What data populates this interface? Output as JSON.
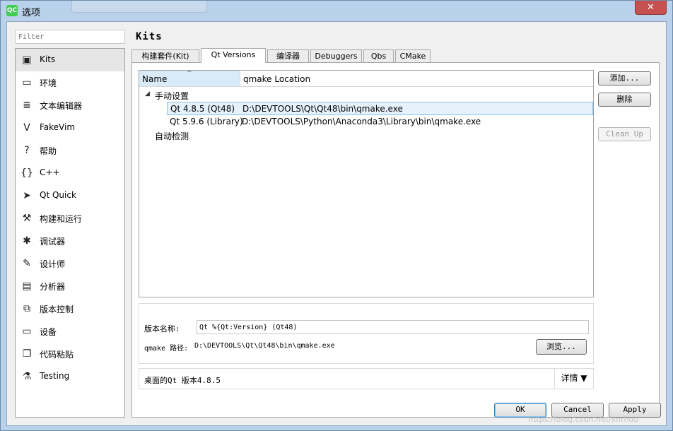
{
  "window": {
    "app_icon": "QC",
    "title": "选项",
    "close_glyph": "✕"
  },
  "filter": {
    "placeholder": "Filter"
  },
  "sidebar": {
    "items": [
      {
        "label": "Kits",
        "icon": "kits-icon",
        "glyph": "▣",
        "selected": true
      },
      {
        "label": "环境",
        "icon": "monitor-icon",
        "glyph": "▭"
      },
      {
        "label": "文本编辑器",
        "icon": "text-editor-icon",
        "glyph": "≣"
      },
      {
        "label": "FakeVim",
        "icon": "fakevim-icon",
        "glyph": "V"
      },
      {
        "label": "帮助",
        "icon": "help-icon",
        "glyph": "?"
      },
      {
        "label": "C++",
        "icon": "cpp-icon",
        "glyph": "{}"
      },
      {
        "label": "Qt Quick",
        "icon": "qt-quick-icon",
        "glyph": "➤"
      },
      {
        "label": "构建和运行",
        "icon": "hammer-icon",
        "glyph": "⚒"
      },
      {
        "label": "调试器",
        "icon": "bug-icon",
        "glyph": "✱"
      },
      {
        "label": "设计师",
        "icon": "pencil-icon",
        "glyph": "✎"
      },
      {
        "label": "分析器",
        "icon": "analyzer-icon",
        "glyph": "▤"
      },
      {
        "label": "版本控制",
        "icon": "version-control-icon",
        "glyph": "⧉"
      },
      {
        "label": "设备",
        "icon": "device-icon",
        "glyph": "▭"
      },
      {
        "label": "代码粘贴",
        "icon": "clipboard-icon",
        "glyph": "❐"
      },
      {
        "label": "Testing",
        "icon": "flask-icon",
        "glyph": "⚗"
      }
    ]
  },
  "page": {
    "title": "Kits"
  },
  "tabs": [
    {
      "label": "构建套件(Kit)"
    },
    {
      "label": "Qt Versions",
      "active": true
    },
    {
      "label": "编译器"
    },
    {
      "label": "Debuggers"
    },
    {
      "label": "Qbs"
    },
    {
      "label": "CMake"
    }
  ],
  "tree": {
    "columns": {
      "name": "Name",
      "location": "qmake Location"
    },
    "sort_glyph": "^",
    "groups": [
      {
        "label": "手动设置",
        "expander": "◢",
        "rows": [
          {
            "name": "Qt 4.8.5 (Qt48)",
            "location": "D:\\DEVTOOLS\\Qt\\Qt48\\bin\\qmake.exe",
            "selected": true
          },
          {
            "name": "Qt 5.9.6 (Library)",
            "location": "D:\\DEVTOOLS\\Python\\Anaconda3\\Library\\bin\\qmake.exe"
          }
        ]
      },
      {
        "label": "自动检测",
        "rows": []
      }
    ]
  },
  "side_buttons": {
    "add": "添加...",
    "remove": "删除",
    "clean_up": "Clean Up"
  },
  "details": {
    "version_name_label": "版本名称:",
    "version_name_value": "Qt %{Qt:Version} (Qt48)",
    "qmake_path_label": "qmake 路径:",
    "qmake_path_value": "D:\\DEVTOOLS\\Qt\\Qt48\\bin\\qmake.exe",
    "browse": "浏览..."
  },
  "summary": {
    "text": "桌面的Qt 版本4.8.5",
    "detail_button": "详情 ▼"
  },
  "footer": {
    "ok": "OK",
    "cancel": "Cancel",
    "apply": "Apply"
  },
  "watermark": "https://blog.csdn.net/xnrhdu"
}
